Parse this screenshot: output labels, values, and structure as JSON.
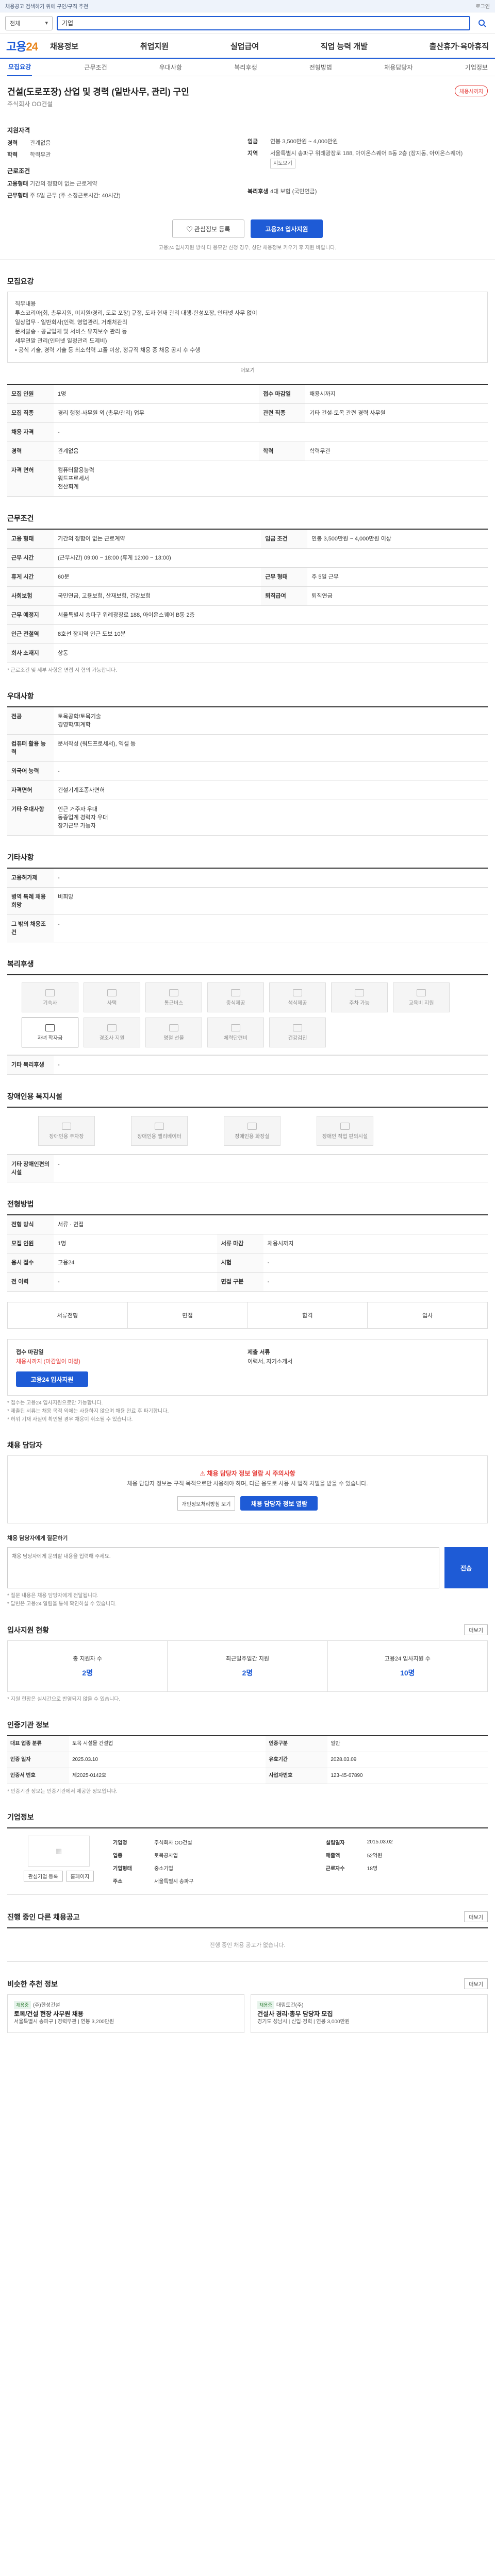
{
  "top_banner": {
    "text": "채용공고 검색하기 위에 구인/구직 추천",
    "right": "로그인"
  },
  "search": {
    "category": "전체",
    "value": "기업"
  },
  "logo": {
    "main": "고용",
    "accent": "24"
  },
  "gnb": [
    "채용정보",
    "취업지원",
    "실업급여",
    "직업 능력 개발",
    "출산휴가·육아휴직"
  ],
  "tabs": [
    "모집요강",
    "근무조건",
    "우대사항",
    "복리후생",
    "전형방법",
    "채용담당자",
    "기업정보"
  ],
  "job": {
    "title": "건설(도로포장) 산업 및 경력 (일반사무, 관리) 구인",
    "company": "주식회사 OO건설",
    "badge": "채용시까지",
    "grp_req": "지원자격",
    "grp_cond": "근로조건",
    "left": [
      {
        "k": "경력",
        "v": "관계없음"
      },
      {
        "k": "학력",
        "v": "학력무관"
      }
    ],
    "right": [
      {
        "k": "임금",
        "v": "연봉 3,500만원 ~ 4,000만원"
      },
      {
        "k": "지역",
        "v": "서울특별시 송파구 위례광장로 188, 아이온스퀘어 B동 2층 (장지동, 아이온스퀘어)"
      }
    ],
    "map_label": "지도보기",
    "left2": [
      {
        "k": "고용형태",
        "v": "기간의 정함이 없는 근로계약"
      },
      {
        "k": "근무형태",
        "v": "주 5일 근무 (주 소정근로시간: 40시간)"
      }
    ],
    "right2": [
      {
        "k": "복리후생",
        "v": "4대 보험 (국민연금)"
      }
    ],
    "btn_scrap": "관심정보 등록",
    "btn_apply": "고용24 입사지원",
    "apply_note": "고용24 입사지원 방식 다 응모만 신청 경우, 상단 채용정보 키우기 후 지원 바랍니다."
  },
  "recruit": {
    "h": "모집요강",
    "body": "직무내용\n투스코리아[회, 총무지원, 미지원/경리, 도로 포장] 규정, 도자 현재 관리 대행·한성포장, 인터넷 사무 없이\n일상업무 - 일반회사(인력, 영업관리, 거래처관리\n문서발송 - 공급업체 및 서비스 유지보수 관리 등\n세무연말 관리(인터넷 일정관리 도제비)\n• 공식 기술, 경력 기술 등 최소학력 고졸 이상, 정규직 채용 중 채용 공지 후 수행",
    "more": "더보기",
    "rows": [
      {
        "k1": "모집 인원",
        "v1": "1명",
        "k2": "접수 마감일",
        "v2": "채용시까지"
      },
      {
        "k1": "모집 직종",
        "v1": "경리 행정·사무원 외 (총무/관리) 업무",
        "k2": "관련 직종",
        "v2": "기타 건설·토목 관련 경력 사무원"
      },
      {
        "k1": "채용 자격",
        "v1": "-",
        "k2": "",
        "v2": ""
      },
      {
        "k1": "경력",
        "v1": "관계없음",
        "k2": "학력",
        "v2": "학력무관"
      },
      {
        "k1": "자격 면허",
        "v1": "컴퓨터활용능력\n워드프로세서\n전산회계",
        "k2": "",
        "v2": ""
      }
    ]
  },
  "work": {
    "h": "근무조건",
    "rows": [
      {
        "k1": "고용 형태",
        "v1": "기간의 정함이 없는 근로계약",
        "k2": "임금 조건",
        "v2": "연봉 3,500만원 ~ 4,000만원 이상"
      },
      {
        "k1": "근무 시간",
        "v1": "(근무시간) 09:00 ~ 18:00 (휴게 12:00 ~ 13:00)",
        "k2": "",
        "v2": ""
      },
      {
        "k1": "휴게 시간",
        "v1": "60분",
        "k2": "근무 형태",
        "v2": "주 5일 근무"
      },
      {
        "k1": "사회보험",
        "v1": "국민연금, 고용보험, 산재보험, 건강보험",
        "k2": "퇴직급여",
        "v2": "퇴직연금"
      },
      {
        "k1": "근무 예정지",
        "v1": "서울특별시 송파구 위례광장로 188, 아이온스퀘어 B동 2층",
        "k2": "",
        "v2": ""
      },
      {
        "k1": "인근 전철역",
        "v1": "8호선 장지역 인근 도보 10분",
        "k2": "",
        "v2": ""
      },
      {
        "k1": "회사 소재지",
        "v1": "상동",
        "k2": "",
        "v2": ""
      }
    ],
    "note": "* 근로조건 및 세부 사항은 면접 시 협의 가능합니다."
  },
  "pref": {
    "h": "우대사항",
    "rows": [
      {
        "k": "전공",
        "v": "토목공학/토목기술\n경영학/회계학"
      },
      {
        "k": "컴퓨터 활용 능력",
        "v": "문서작성 (워드프로세서), 엑셀 등"
      },
      {
        "k": "외국어 능력",
        "v": "-"
      },
      {
        "k": "자격면허",
        "v": "건설기계조종사면허"
      },
      {
        "k": "기타 우대사항",
        "v": "인근 거주자 우대\n동종업계 경력자 우대\n장기근무 가능자"
      }
    ]
  },
  "other": {
    "h": "기타사항",
    "rows": [
      {
        "k": "고용허가제",
        "v": "-"
      },
      {
        "k": "병역 특례 채용 희망",
        "v": "비희망"
      },
      {
        "k": "그 밖의 채용조건",
        "v": "-"
      }
    ]
  },
  "welfare": {
    "h": "복리후생",
    "items": [
      "기숙사",
      "사택",
      "통근버스",
      "중식제공",
      "석식제공",
      "주차 가능",
      "교육비 지원",
      "자녀 학자금",
      "경조사 지원",
      "명절 선물",
      "체력단련비",
      "건강검진"
    ],
    "on": [
      7
    ],
    "etc_k": "기타 복리후생",
    "etc_v": "-"
  },
  "disab": {
    "h": "장애인용 복지시설",
    "items": [
      "장애인용 주차장",
      "장애인용 엘리베이터",
      "장애인용 화장실",
      "장애인 작업 편의시설"
    ],
    "etc_k": "기타 장애인편의시설",
    "etc_v": "-"
  },
  "select": {
    "h": "전형방법",
    "rows": [
      {
        "k1": "전형 방식",
        "v1": "서류 · 면접",
        "k2": "",
        "v2": ""
      },
      {
        "k1": "모집 인원",
        "v1": "1명",
        "k2": "서류 마감",
        "v2": "채용시까지"
      },
      {
        "k1": "응시 접수",
        "v1": "고용24",
        "k2": "시험",
        "v2": "-"
      },
      {
        "k1": "전 이력",
        "v1": "-",
        "k2": "면접 구분",
        "v2": "-"
      }
    ],
    "steps": [
      "서류전형",
      "면접",
      "합격",
      "입사"
    ],
    "doc_h": "접수 마감일",
    "doc_v": "채용시까지 (마감일이 미정)",
    "apply_h": "제출 서류",
    "apply_v": "이력서, 자기소개서",
    "btn": "고용24 입사지원",
    "notes": [
      "* 접수는 고용24 입사지원으로만 가능합니다.",
      "* 제출된 서류는 채용 목적 외에는 사용하지 않으며 채용 완료 후 파기합니다.",
      "* 허위 기재 사실이 확인될 경우 채용이 취소될 수 있습니다."
    ]
  },
  "contact": {
    "h": "채용 담당자",
    "warn": "채용 담당자 정보 열람 시 주의사항",
    "warn_body": "채용 담당자 정보는 구직 목적으로만 사용해야 하며, 다른 용도로 사용 시 법적 처벌을 받을 수 있습니다.",
    "btn1": "개인정보처리방침 보기",
    "btn2": "채용 담당자 정보 열람",
    "qa_label": "채용 담당자에게 질문하기",
    "qa_ph": "채용 담당자에게 문의할 내용을 입력해 주세요.",
    "qa_btn": "전송",
    "qa_notes": [
      "* 질문 내용은 채용 담당자에게 전달됩니다.",
      "* 답변은 고용24 알림을 통해 확인하실 수 있습니다."
    ]
  },
  "stats": {
    "h": "입사지원 현황",
    "more": "더보기",
    "items": [
      {
        "l": "총 지원자 수",
        "n": "2명"
      },
      {
        "l": "최근일주일간 지원",
        "n": "2명"
      },
      {
        "l": "고용24 입사지원 수",
        "n": "10명"
      }
    ],
    "note": "* 지원 현황은 실시간으로 반영되지 않을 수 있습니다."
  },
  "info": {
    "h": "인증기관 정보",
    "rows": [
      {
        "k1": "대표 업종 분류",
        "v1": "토목 시설물 건설업",
        "k2": "인증구분",
        "v2": "일반"
      },
      {
        "k1": "인증 일자",
        "v1": "2025.03.10",
        "k2": "유효기간",
        "v2": "2028.03.09"
      },
      {
        "k1": "인증서 번호",
        "v1": "제2025-0142호",
        "k2": "사업자번호",
        "v2": "123-45-67890"
      }
    ],
    "note": "* 인증기관 정보는 인증기관에서 제공한 정보입니다."
  },
  "company": {
    "h": "기업정보",
    "btn1": "관심기업 등록",
    "btn2": "홈페이지",
    "rows": [
      {
        "k1": "기업명",
        "v1": "주식회사 OO건설",
        "k2": "설립일자",
        "v2": "2015.03.02"
      },
      {
        "k1": "업종",
        "v1": "토목공사업",
        "k2": "매출액",
        "v2": "52억원"
      },
      {
        "k1": "기업형태",
        "v1": "중소기업",
        "k2": "근로자수",
        "v2": "18명"
      },
      {
        "k1": "주소",
        "v1": "서울특별시 송파구",
        "k2": "",
        "v2": ""
      }
    ]
  },
  "history": {
    "h": "진행 중인 다른 채용공고",
    "more": "더보기",
    "empty": "진행 중인 채용 공고가 없습니다."
  },
  "rec": {
    "h": "비슷한 추천 정보",
    "more": "더보기",
    "cards": [
      {
        "tag": "채용중",
        "t": "토목/건설 현장 사무원 채용",
        "c": "(주)한성건설",
        "d": "서울특별시 송파구 | 경력무관 | 연봉 3,200만원"
      },
      {
        "tag": "채용중",
        "t": "건설사 경리·총무 담당자 모집",
        "c": "대림토건(주)",
        "d": "경기도 성남시 | 신입·경력 | 연봉 3,000만원"
      }
    ]
  }
}
